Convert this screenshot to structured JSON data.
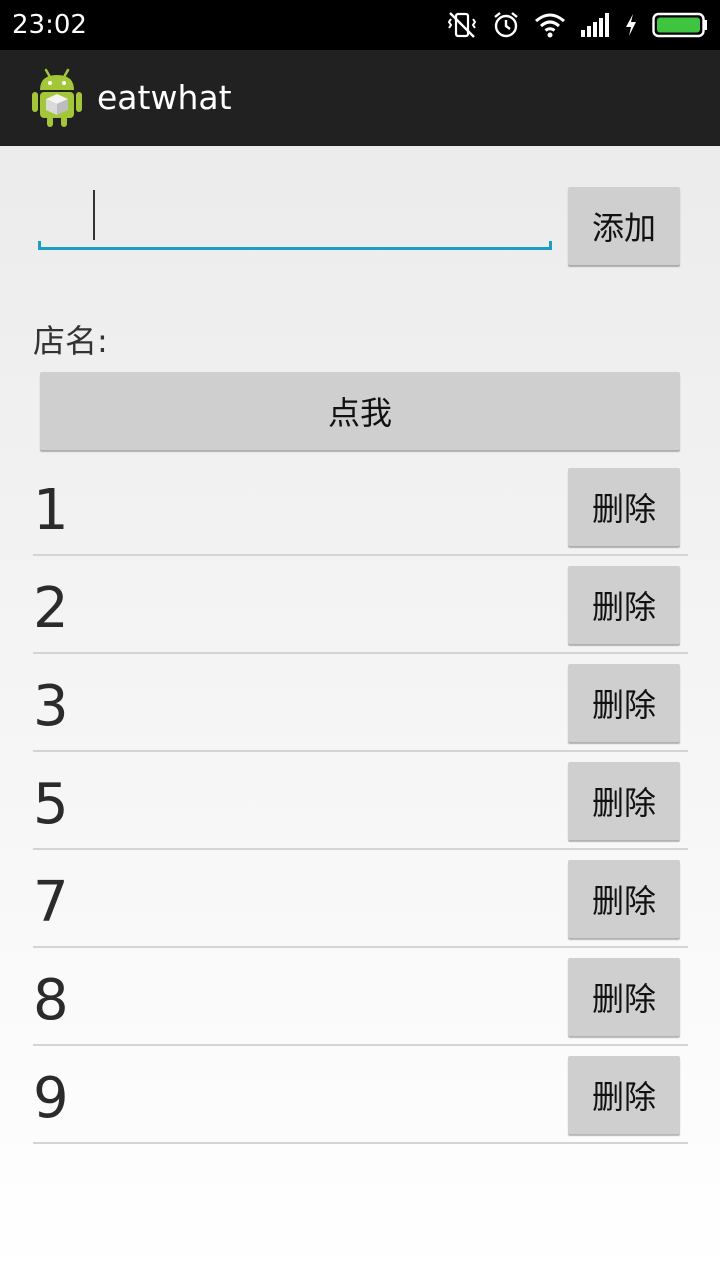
{
  "status_bar": {
    "time": "23:02",
    "icons": [
      "vibrate-off-icon",
      "alarm-icon",
      "wifi-icon",
      "signal-icon",
      "charging-icon",
      "battery-icon"
    ],
    "battery_color": "#3ec43e"
  },
  "action_bar": {
    "title": "eatwhat",
    "icon": "android-app-icon"
  },
  "add_row": {
    "input_value": "",
    "input_placeholder": "",
    "add_label": "添加"
  },
  "shop_label": "店名:",
  "click_button_label": "点我",
  "list": {
    "items": [
      {
        "number": "1",
        "delete_label": "删除"
      },
      {
        "number": "2",
        "delete_label": "删除"
      },
      {
        "number": "3",
        "delete_label": "删除"
      },
      {
        "number": "5",
        "delete_label": "删除"
      },
      {
        "number": "7",
        "delete_label": "删除"
      },
      {
        "number": "8",
        "delete_label": "删除"
      },
      {
        "number": "9",
        "delete_label": "删除"
      }
    ]
  },
  "colors": {
    "accent": "#1e9ec4",
    "action_bar": "#212121",
    "button": "#cfcfcf"
  }
}
